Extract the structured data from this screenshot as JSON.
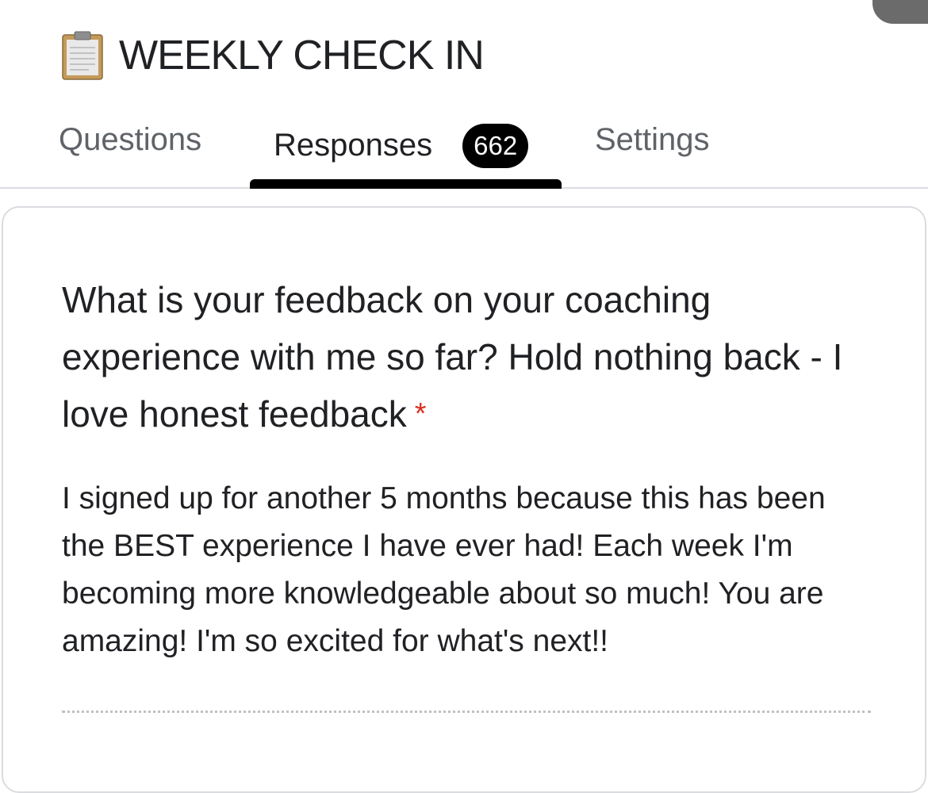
{
  "form": {
    "title": "WEEKLY CHECK IN",
    "title_icon": "clipboard-icon"
  },
  "tabs": {
    "questions_label": "Questions",
    "responses_label": "Responses",
    "responses_count": "662",
    "settings_label": "Settings",
    "active": "Responses"
  },
  "response_card": {
    "question": "What is your feedback on your coaching experience with me so far? Hold nothing back - I love honest feedback",
    "required_marker": "*",
    "answer": "I signed up for another 5 months because this has been the BEST experience I have ever had! Each week I'm becoming more knowledgeable about so much! You are amazing! I'm so excited for what's next!!"
  },
  "colors": {
    "accent": "#000000",
    "required": "#d93025",
    "text": "#202124",
    "muted_text": "#5f6368",
    "divider": "#dadce0"
  }
}
